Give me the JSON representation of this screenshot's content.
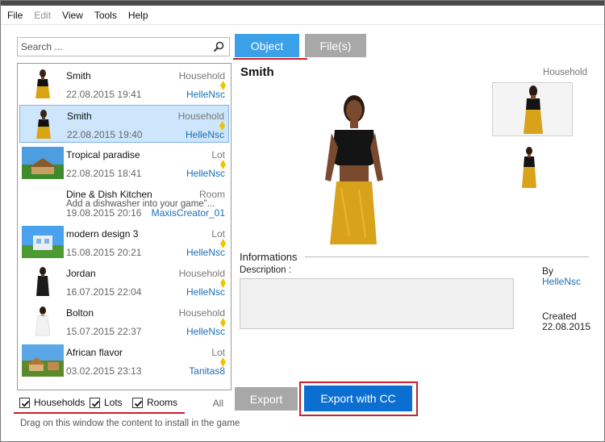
{
  "menu": [
    "File",
    "Edit",
    "View",
    "Tools",
    "Help"
  ],
  "menu_disabled": [
    false,
    true,
    false,
    false,
    false
  ],
  "search": {
    "placeholder": "Search ..."
  },
  "list": [
    {
      "name": "Smith",
      "type": "Household",
      "date": "22.08.2015 19:41",
      "author": "HelleNsc",
      "thumb": "sim-woman-black-top",
      "selected": false
    },
    {
      "name": "Smith",
      "type": "Household",
      "date": "22.08.2015 19:40",
      "author": "HelleNsc",
      "thumb": "sim-woman-black-top",
      "selected": true
    },
    {
      "name": "Tropical paradise",
      "type": "Lot",
      "date": "22.08.2015 18:41",
      "author": "HelleNsc",
      "thumb": "lot-house",
      "selected": false
    },
    {
      "name": "Dine & Dish Kitchen",
      "type": "Room",
      "desc": "Add a dishwasher into your game\"...",
      "date": "19.08.2015 20:16",
      "author": "MaxisCreator_01",
      "thumb": "none",
      "selected": false
    },
    {
      "name": "modern design 3",
      "type": "Lot",
      "date": "15.08.2015 20:21",
      "author": "HelleNsc",
      "thumb": "lot-modern",
      "selected": false
    },
    {
      "name": "Jordan",
      "type": "Household",
      "date": "16.07.2015 22:04",
      "author": "HelleNsc",
      "thumb": "sim-woman-black-dress",
      "selected": false
    },
    {
      "name": "Bolton",
      "type": "Household",
      "date": "15.07.2015 22:37",
      "author": "HelleNsc",
      "thumb": "sim-woman-white-dress",
      "selected": false
    },
    {
      "name": "African flavor",
      "type": "Lot",
      "date": "03.02.2015 23:13",
      "author": "Tanitas8",
      "thumb": "lot-african",
      "selected": false
    }
  ],
  "filters": {
    "households": "Households",
    "lots": "Lots",
    "rooms": "Rooms",
    "all": "All"
  },
  "hint": "Drag on this window the content to install in the game",
  "tabs": {
    "object": "Object",
    "files": "File(s)"
  },
  "detail": {
    "title": "Smith",
    "category": "Household",
    "informations": "Informations",
    "description_label": "Description :",
    "by_label": "By",
    "by_value": "HelleNsc",
    "created_label": "Created",
    "created_value": "22.08.2015"
  },
  "buttons": {
    "export": "Export",
    "export_cc": "Export with CC"
  },
  "colors": {
    "accent": "#0a6fd1",
    "tab_active": "#3aa0e8",
    "highlight": "#c8202e",
    "link": "#1a6fb5"
  }
}
